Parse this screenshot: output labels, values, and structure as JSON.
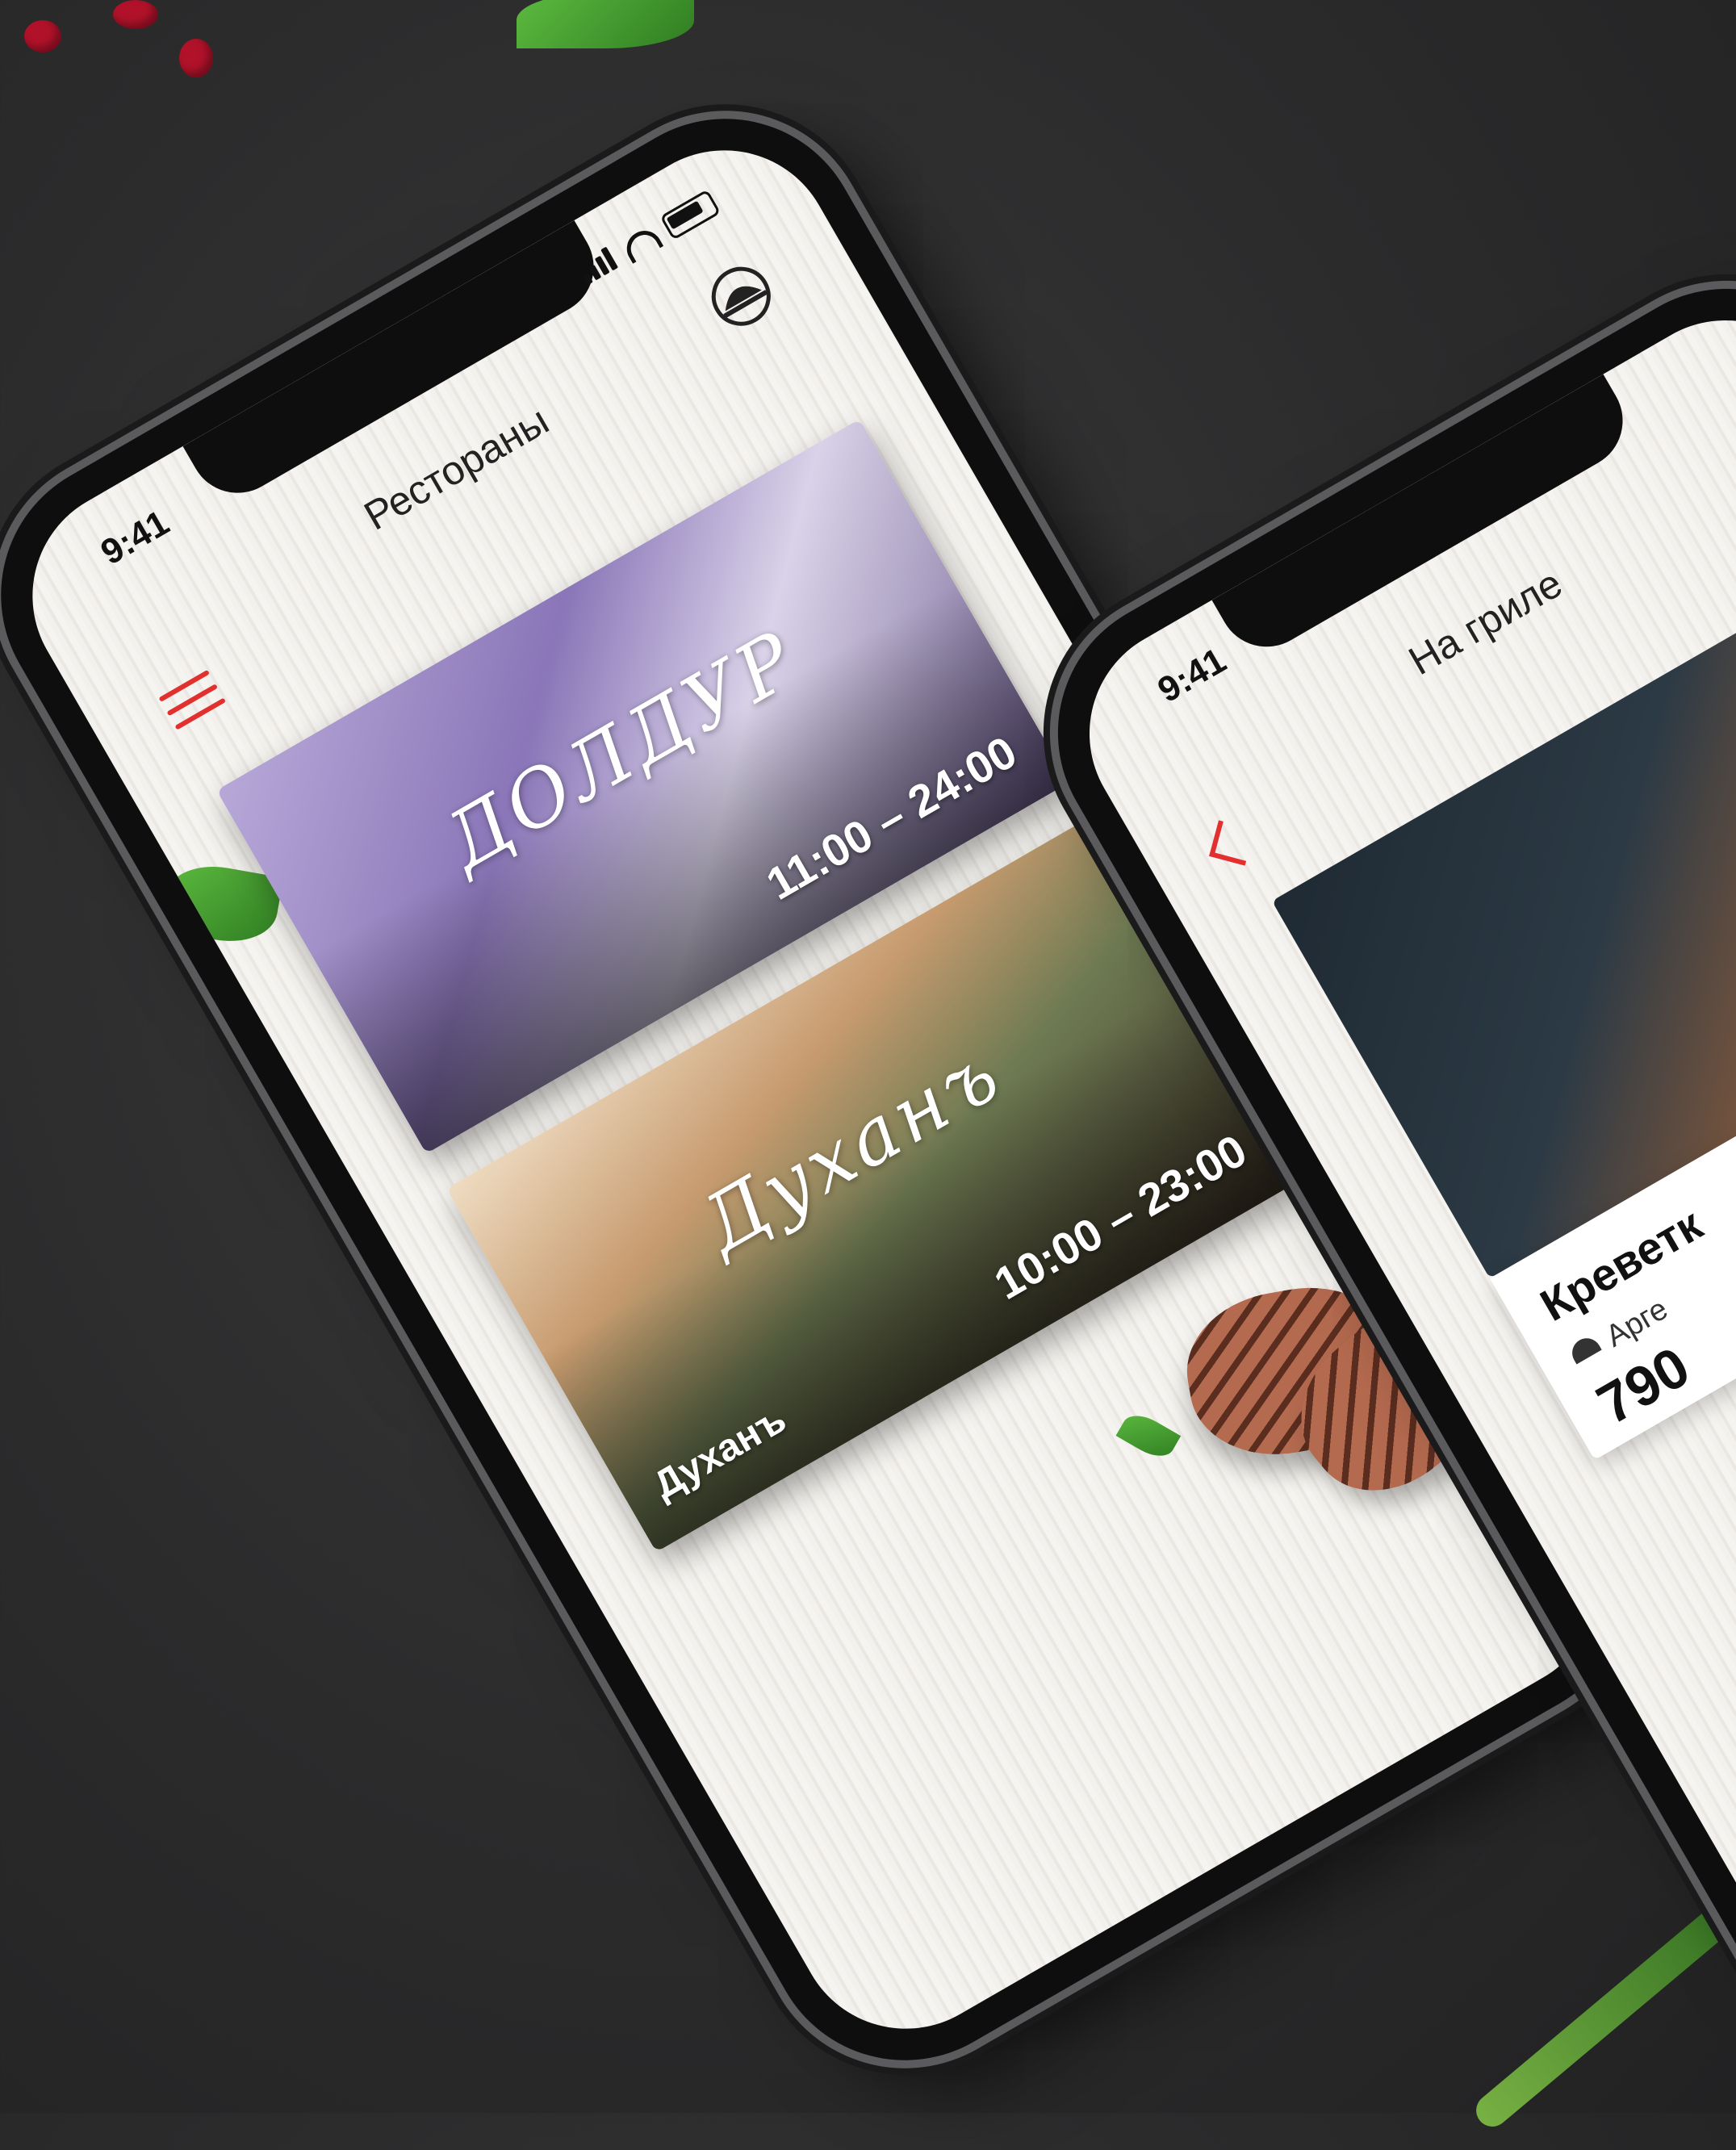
{
  "main_phone": {
    "status": {
      "time": "9:41"
    },
    "header": {
      "title": "Рестораны"
    },
    "restaurants": [
      {
        "logo": "ДОЛДУР",
        "hours": "11:00 – 24:00",
        "caption": ""
      },
      {
        "logo": "Духанъ",
        "hours": "10:00 – 23:00",
        "caption": "Духанъ"
      }
    ]
  },
  "second_phone": {
    "status": {
      "time": "9:41"
    },
    "header": {
      "title": "На гриле"
    },
    "dish": {
      "name": "Креветк",
      "restaurant": "Арге",
      "price": "790"
    }
  },
  "colors": {
    "accent": "#e2302f",
    "background": "#2b2b2c"
  },
  "icons": [
    "menu-icon",
    "cloche-icon",
    "back-icon",
    "signal-icon",
    "wifi-icon",
    "battery-icon"
  ]
}
